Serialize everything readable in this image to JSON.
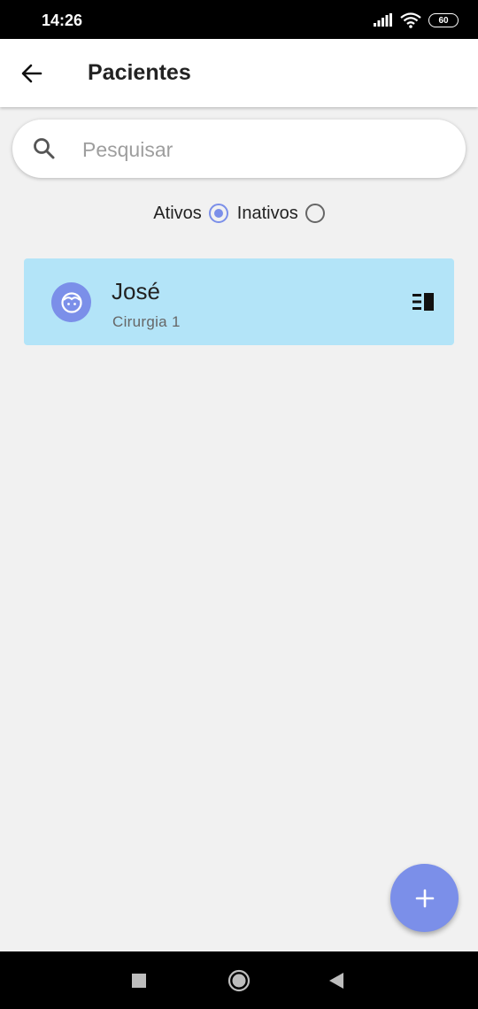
{
  "status_bar": {
    "time": "14:26",
    "battery": "60"
  },
  "header": {
    "title": "Pacientes"
  },
  "search": {
    "placeholder": "Pesquisar",
    "value": ""
  },
  "filter": {
    "active_label": "Ativos",
    "inactive_label": "Inativos",
    "selected": "Ativos"
  },
  "patients": [
    {
      "name": "José",
      "subtitle": "Cirurgia 1"
    }
  ],
  "colors": {
    "accent": "#7b8fe9",
    "card_bg": "#b3e4f8",
    "background": "#f1f1f1"
  },
  "icons": [
    "back-arrow-icon",
    "search-icon",
    "patient-avatar-icon",
    "details-menu-icon",
    "add-icon",
    "recent-apps-icon",
    "home-icon",
    "nav-back-icon"
  ]
}
